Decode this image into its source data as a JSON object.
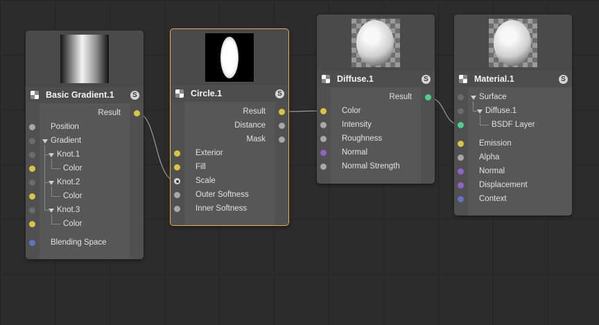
{
  "nodes": {
    "basic_gradient": {
      "title": "Basic Gradient.1",
      "badge": "S",
      "output_label": "Result",
      "inputs": {
        "position": "Position",
        "gradient": "Gradient",
        "knot1": "Knot.1",
        "knot1_color": "Color",
        "knot2": "Knot.2",
        "knot2_color": "Color",
        "knot3": "Knot.3",
        "knot3_color": "Color",
        "blending_space": "Blending Space"
      }
    },
    "circle": {
      "title": "Circle.1",
      "badge": "S",
      "outputs": {
        "result": "Result",
        "distance": "Distance",
        "mask": "Mask"
      },
      "inputs": {
        "exterior": "Exterior",
        "fill": "Fill",
        "scale": "Scale",
        "outer_softness": "Outer Softness",
        "inner_softness": "Inner Softness"
      }
    },
    "diffuse": {
      "title": "Diffuse.1",
      "badge": "S",
      "output_label": "Result",
      "inputs": {
        "color": "Color",
        "intensity": "Intensity",
        "roughness": "Roughness",
        "normal": "Normal",
        "normal_strength": "Normal Strength"
      }
    },
    "material": {
      "title": "Material.1",
      "badge": "S",
      "inputs": {
        "surface": "Surface",
        "diffuse": "Diffuse.1",
        "bsdf_layer": "BSDF Layer",
        "emission": "Emission",
        "alpha": "Alpha",
        "normal": "Normal",
        "displacement": "Displacement",
        "context": "Context"
      }
    }
  },
  "colors": {
    "canvas": "#2c2c2c",
    "node": "#575757",
    "selected_border": "#e6b24a",
    "port_color": "#dcc340",
    "port_bsdf": "#4fd08a",
    "port_vector": "#9263c6",
    "port_context": "#6172c4"
  }
}
